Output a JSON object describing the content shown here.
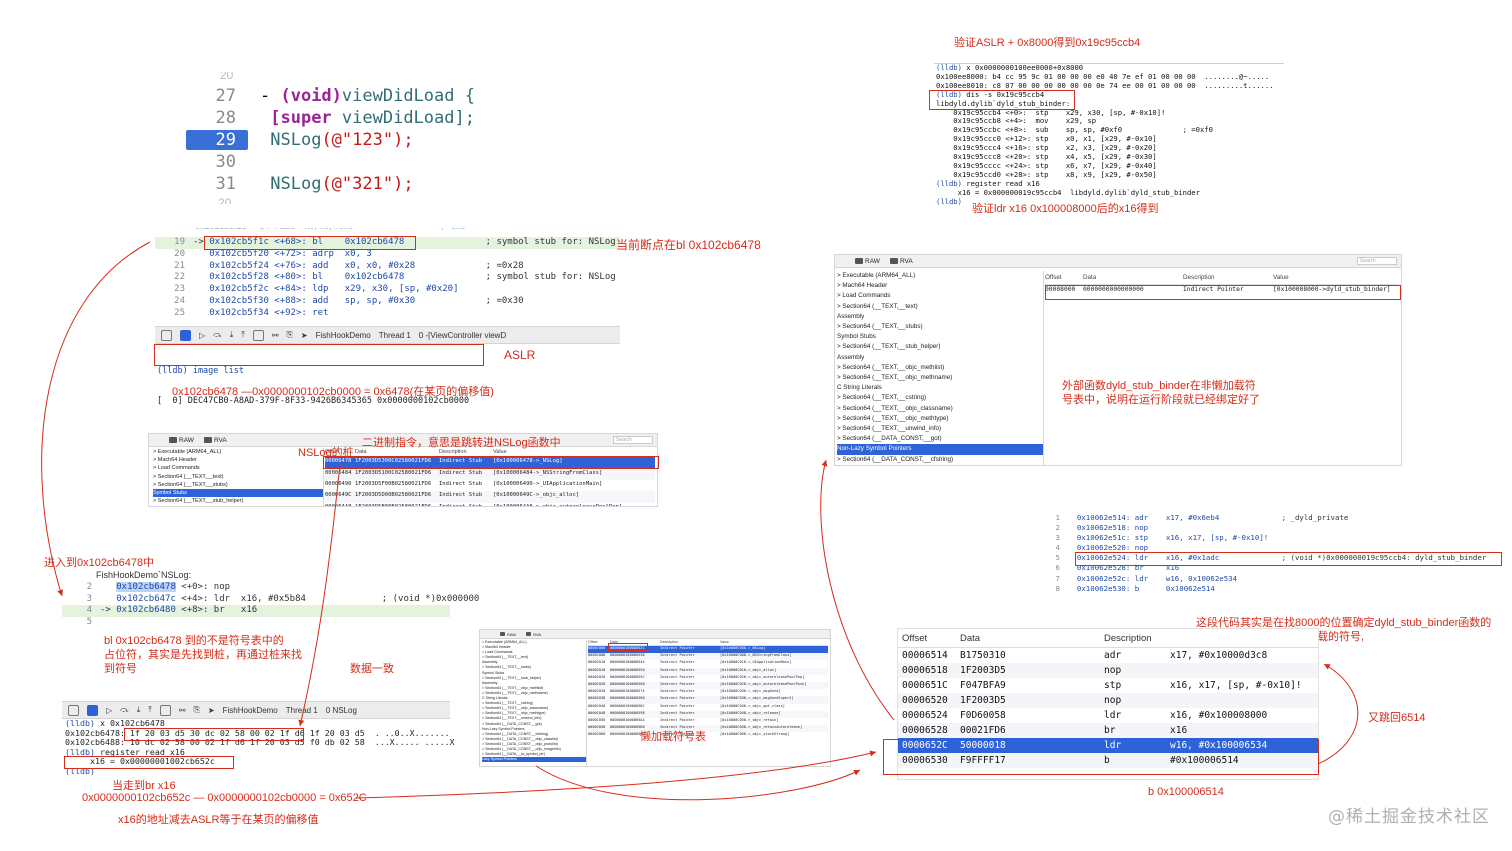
{
  "source": {
    "lines": [
      {
        "n": "27",
        "dash": "-",
        "kw": "(void)",
        "rest": "viewDidLoad {"
      },
      {
        "n": "28",
        "kw": "[super",
        "rest": " viewDidLoad];"
      },
      {
        "n": "29",
        "fn": "NSLog",
        "str": "(@\"123\");"
      },
      {
        "n": "30"
      },
      {
        "n": "31",
        "fn": "NSLog",
        "str": "(@\"321\");"
      }
    ]
  },
  "disasm1": [
    {
      "n": "19",
      "arrow": "->",
      "addr": "0x102cb5f1c <+68>: bl",
      "ops": "0x102cb6478",
      "cmt": "; symbol stub for: NSLog"
    },
    {
      "n": "20",
      "addr": "0x102cb5f20 <+72>: adrp",
      "ops": "x0, 3",
      "cmt": ""
    },
    {
      "n": "21",
      "addr": "0x102cb5f24 <+76>: add",
      "ops": "x0, x0, #0x28",
      "cmt": "; =0x28"
    },
    {
      "n": "22",
      "addr": "0x102cb5f28 <+80>: bl",
      "ops": "0x102cb6478",
      "cmt": "; symbol stub for: NSLog"
    },
    {
      "n": "23",
      "addr": "0x102cb5f2c <+84>: ldp",
      "ops": "x29, x30, [sp, #0x20]",
      "cmt": ""
    },
    {
      "n": "24",
      "addr": "0x102cb5f30 <+88>: add",
      "ops": "sp, sp, #0x30",
      "cmt": "; =0x30"
    },
    {
      "n": "25",
      "addr": "0x102cb5f34 <+92>: ret",
      "ops": "",
      "cmt": ""
    }
  ],
  "toolbar1": {
    "target": "FishHookDemo",
    "thread": "Thread 1",
    "frame": "0 -[ViewController viewD"
  },
  "console1": {
    "prompt": "(lldb) image list",
    "line": "[  0] DEC47CB0-A8AD-379F-8F33-9426B6345365 0x0000000102cb0000"
  },
  "anno": {
    "top_right": "验证ASLR + 0x8000得到0x19c95ccb4",
    "verify_ldr": "验证ldr x16  0x100008000后的x16得到",
    "current_bp": "当前断点在bl    0x102cb6478",
    "aslr": "ASLR",
    "offset_calc": "0x102cb6478 —0x0000000102cb0000  =  0x6478(在某页的偏移值)",
    "nslog_stub": "NSLog的桩",
    "binary_instr": "二进制指令，意思是跳转进NSLog函数中",
    "enter": "进入到0x102cb6478中",
    "bl_note_1": "bl    0x102cb6478   到的不是符号表中的",
    "bl_note_2": "占位符，其实是先找到桩，再通过桩来找",
    "bl_note_3": "到符号",
    "data_match": "数据一致",
    "lazy_table": "懒加载符号表",
    "ext_1": "外部函数dyld_stub_binder在非懒加载符",
    "ext_2": "号表中，说明在运行阶段就已经绑定好了",
    "find_1": "这段代码其实是在找8000的位置确定dyld_stub_binder函数的",
    "find_2": "位置来进行绑定那些懒加载的符号,",
    "jump_back": "又跳回6514",
    "b_target": "b 0x100006514",
    "br_note": "当走到br  x16",
    "br_calc": "0x0000000102cb652c — 0x0000000102cb0000 = 0x652C",
    "br_note2": "x16的地址减去ASLR等于在某页的偏移值"
  },
  "lldb_top": [
    {
      "p": "(lldb)",
      "t": " x 0x0000000100ee0000+0x8000"
    },
    {
      "p": "",
      "t": "0x100ee8000: b4 cc 95 9c 01 00 00 00 e0 40 7e ef 01 00 00 00  ........@~....."
    },
    {
      "p": "",
      "t": "0x100ee8010: c8 07 00 00 00 00 00 00 0e 74 ee 00 01 00 00 00  .........t......"
    },
    {
      "p": "(lldb)",
      "t": " dis -s 0x19c95ccb4"
    },
    {
      "p": "",
      "t": "libdyld.dylib`dyld_stub_binder:"
    },
    {
      "p": "",
      "t": "    0x19c95ccb4 <+0>:  stp    x29, x30, [sp, #-0x10]!"
    },
    {
      "p": "",
      "t": "    0x19c95ccb8 <+4>:  mov    x29, sp"
    },
    {
      "p": "",
      "t": "    0x19c95ccbc <+8>:  sub    sp, sp, #0xf0              ; =0xf0"
    },
    {
      "p": "",
      "t": "    0x19c95ccc0 <+12>: stp    x0, x1, [x29, #-0x10]"
    },
    {
      "p": "",
      "t": "    0x19c95ccc4 <+16>: stp    x2, x3, [x29, #-0x20]"
    },
    {
      "p": "",
      "t": "    0x19c95ccc8 <+20>: stp    x4, x5, [x29, #-0x30]"
    },
    {
      "p": "",
      "t": "    0x19c95cccc <+24>: stp    x6, x7, [x29, #-0x40]"
    },
    {
      "p": "",
      "t": "    0x19c95ccd0 <+28>: stp    x8, x9, [x29, #-0x50]"
    },
    {
      "p": "(lldb)",
      "t": " register read x16"
    },
    {
      "p": "",
      "t": "     x16 = 0x000000019c95ccb4  libdyld.dylib`dyld_stub_binder"
    },
    {
      "p": "(lldb)",
      "t": ""
    }
  ],
  "mv_right": {
    "tabs": [
      "RAW",
      "RVA"
    ],
    "search": "Search",
    "tree": [
      "Executable (ARM64_ALL)",
      "  Mach64 Header",
      "  Load Commands",
      "  Section64 (__TEXT,__text)",
      "     Assembly",
      "  Section64 (__TEXT,__stubs)",
      "     Symbol Stubs",
      "  Section64 (__TEXT,__stub_helper)",
      "     Assembly",
      "  Section64 (__TEXT,__objc_methlist)",
      "  Section64 (__TEXT,__objc_methname)",
      "     C String Literals",
      "  Section64 (__TEXT,__cstring)",
      "  Section64 (__TEXT,__objc_classname)",
      "  Section64 (__TEXT,__objc_methtype)",
      "  Section64 (__TEXT,__unwind_info)",
      "  Section64 (__DATA_CONST,__got)",
      "     Non-Lazy Symbol Pointers",
      "  Section64 (__DATA_CONST,__cfstring)"
    ],
    "cols": [
      "Offset",
      "Data",
      "Description",
      "Value"
    ],
    "row": [
      "00008000",
      "0000000000000000",
      "Indirect Pointer",
      "[0x100008000->dyld_stub_binder]"
    ]
  },
  "mv_mid": {
    "tabs": [
      "RAW",
      "RVA"
    ],
    "search": "Search",
    "tree": [
      "Executable (ARM64_ALL)",
      "  Mach64 Header",
      "  Load Commands",
      "  Section64 (__TEXT,__text)",
      "  Section64 (__TEXT,__stubs)",
      "     Symbol Stubs",
      "  Section64 (__TEXT,__stub_helper)"
    ],
    "cols": [
      "Offset",
      "Data",
      "Description",
      "Value"
    ],
    "rows": [
      [
        "00006478",
        "1F2003D5300C02580021FD6",
        "Indirect Stub",
        "[0x100006478->_NSLog]"
      ],
      [
        "00006484",
        "1F2003D5100C02580021FD6",
        "Indirect Stub",
        "[0x100006484->_NSStringFromClass]"
      ],
      [
        "00006490",
        "1F2003D5F00B02580021FD6",
        "Indirect Stub",
        "[0x100006490->_UIApplicationMain]"
      ],
      [
        "0000649C",
        "1F2003D5D00B02580021FD6",
        "Indirect Stub",
        "[0x10000649C->_objc_alloc]"
      ],
      [
        "000064A8",
        "1F2003D5B00B02580021FD6",
        "Indirect Stub",
        "[0x1000064A8->_objc_autoreleasePoolPop]"
      ]
    ]
  },
  "fish": {
    "title": "FishHookDemo`NSLog:",
    "lines": [
      {
        "n": "2",
        "addr": "0x102cb6478",
        "mid": " <+0>: nop",
        "ops": "",
        "cmt": ""
      },
      {
        "n": "3",
        "addr": "0x102cb647c",
        "mid": " <+4>: ldr",
        "ops": "x16, #0x5b84",
        "cmt": "; (void *)0x000000"
      },
      {
        "n": "4",
        "arrow": "->",
        "addr": "0x102cb6480",
        "mid": " <+8>: br",
        "ops": "x16",
        "cmt": ""
      },
      {
        "n": "5",
        "addr": "",
        "mid": "",
        "ops": "",
        "cmt": ""
      }
    ]
  },
  "toolbar2": {
    "target": "FishHookDemo",
    "thread": "Thread 1",
    "frame": "0 NSLog"
  },
  "console2": [
    {
      "p": "(lldb)",
      "t": " x 0x102cb6478"
    },
    {
      "p": "",
      "t": "0x102cb6478: 1f 20 03 d5 30 dc 02 58 00 02 1f d6 1f 20 03 d5  . ..0..X.......",
      "hi": true
    },
    {
      "p": "",
      "t": "0x102cb6488: 10 dc 02 58 00 02 1f d6 1f 20 03 d5 f0 db 02 58  ...X..... .....X"
    },
    {
      "p": "(lldb)",
      "t": " register read x16"
    },
    {
      "p": "",
      "t": "     x16 = 0x00000001002cb652c"
    },
    {
      "p": "(lldb)",
      "t": ""
    }
  ],
  "mv_lazy": {
    "tree": [
      "Executable (ARM64_ALL)",
      "  Mach64 Header",
      "  Load Commands",
      "  Section64 (__TEXT,__text)",
      "     Assembly",
      "  Section64 (__TEXT,__stubs)",
      "     Symbol Stubs",
      "  Section64 (__TEXT,__stub_helper)",
      "     Assembly",
      "  Section64 (__TEXT,__objc_methlist)",
      "  Section64 (__TEXT,__objc_methname)",
      "     C String Literals",
      "  Section64 (__TEXT,__cstring)",
      "  Section64 (__TEXT,__objc_classname)",
      "  Section64 (__TEXT,__objc_methtype)",
      "  Section64 (__TEXT,__unwind_info)",
      "  Section64 (__DATA_CONST,__got)",
      "     Non-Lazy Symbol Pointers",
      "  Section64 (__DATA_CONST,__cfstring)",
      "  Section64 (__DATA_CONST,__objc_classlist)",
      "  Section64 (__DATA_CONST,__objc_protolist)",
      "  Section64 (__DATA_CONST,__objc_imageinfo)",
      "  Section64 (__DATA,__la_symbol_ptr)",
      "     Lazy Symbol Pointers"
    ],
    "cols": [
      "Offset",
      "Data",
      "Description",
      "Value"
    ],
    "rows": [
      [
        "0000C000",
        "000000010000652C",
        "Indirect Pointer",
        "[0x10000C000->_NSLog]"
      ],
      [
        "0000C008",
        "0000000100006538",
        "Indirect Pointer",
        "[0x10000C008->_NSStringFromClass]"
      ],
      [
        "0000C010",
        "0000000100006544",
        "Indirect Pointer",
        "[0x10000C010->_UIApplicationMain]"
      ],
      [
        "0000C018",
        "0000000100006550",
        "Indirect Pointer",
        "[0x10000C018->_objc_alloc]"
      ],
      [
        "0000C020",
        "000000010000655C",
        "Indirect Pointer",
        "[0x10000C020->_objc_autoreleasePoolPop]"
      ],
      [
        "0000C028",
        "0000000100006568",
        "Indirect Pointer",
        "[0x10000C028->_objc_autoreleasePoolPush]"
      ],
      [
        "0000C030",
        "0000000100006574",
        "Indirect Pointer",
        "[0x10000C030->_objc_msgSend]"
      ],
      [
        "0000C038",
        "0000000100006580",
        "Indirect Pointer",
        "[0x10000C038->_objc_msgSendSuper2]"
      ],
      [
        "0000C040",
        "000000010000658C",
        "Indirect Pointer",
        "[0x10000C040->_objc_opt_class]"
      ],
      [
        "0000C048",
        "0000000100006598",
        "Indirect Pointer",
        "[0x10000C048->_objc_release]"
      ],
      [
        "0000C050",
        "00000001000065A4",
        "Indirect Pointer",
        "[0x10000C050->_objc_retain]"
      ],
      [
        "0000C058",
        "00000001000065B0",
        "Indirect Pointer",
        "[0x10000C058->_objc_retainAutorelease]"
      ],
      [
        "0000C060",
        "00000001000065BC",
        "Indirect Pointer",
        "[0x10000C060->_objc_storeStrong]"
      ]
    ]
  },
  "disasm2": [
    {
      "n": "1",
      "addr": "0x10062e514: adr",
      "ops": "x17, #0x6eb4",
      "cmt": "; _dyld_private"
    },
    {
      "n": "2",
      "addr": "0x10062e518: nop",
      "ops": "",
      "cmt": ""
    },
    {
      "n": "3",
      "addr": "0x10062e51c: stp",
      "ops": "x16, x17, [sp, #-0x10]!",
      "cmt": ""
    },
    {
      "n": "4",
      "addr": "0x10062e520: nop",
      "ops": "",
      "cmt": ""
    },
    {
      "n": "5",
      "addr": "0x10062e524: ldr",
      "ops": "x16, #0x1adc",
      "cmt": "; (void *)0x000000019c95ccb4: dyld_stub_binder"
    },
    {
      "n": "6",
      "addr": "0x10062e528: br",
      "ops": "x16",
      "cmt": ""
    },
    {
      "n": "7",
      "addr": "0x10062e52c: ldr",
      "ops": "w16, 0x10062e534",
      "cmt": ""
    },
    {
      "n": "8",
      "addr": "0x10062e530: b",
      "ops": "0x10062e514",
      "cmt": ""
    }
  ],
  "offset_table": {
    "cols": [
      "Offset",
      "Data",
      "Description"
    ],
    "rows": [
      [
        "00006514",
        "B1750310",
        "adr",
        "x17, #0x10000d3c8"
      ],
      [
        "00006518",
        "1F2003D5",
        "nop",
        ""
      ],
      [
        "0000651C",
        "F047BFA9",
        "stp",
        "x16, x17, [sp, #-0x10]!"
      ],
      [
        "00006520",
        "1F2003D5",
        "nop",
        ""
      ],
      [
        "00006524",
        "F0D60058",
        "ldr",
        "x16, #0x100008000"
      ],
      [
        "00006528",
        "00021FD6",
        "br",
        "x16"
      ],
      [
        "0000652C",
        "50000018",
        "ldr",
        "w16, #0x100006534"
      ],
      [
        "00006530",
        "F9FFFF17",
        "b",
        "#0x100006514"
      ]
    ]
  },
  "watermark": "@稀土掘金技术社区"
}
